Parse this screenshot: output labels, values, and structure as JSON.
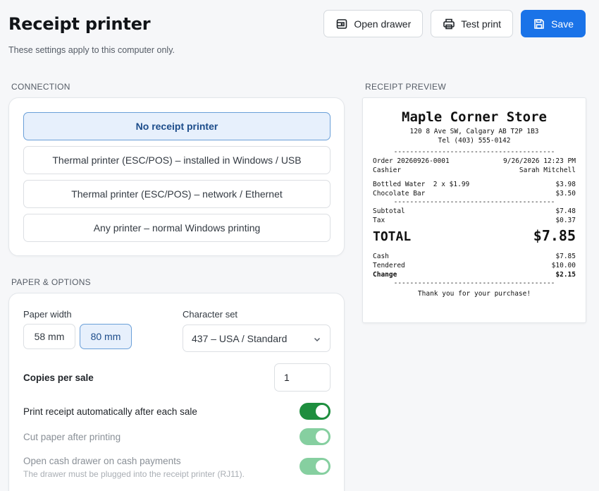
{
  "header": {
    "title": "Receipt printer",
    "subtitle": "These settings apply to this computer only."
  },
  "toolbar": {
    "open_drawer_label": "Open drawer",
    "test_print_label": "Test print",
    "save_label": "Save"
  },
  "connection": {
    "section_label": "CONNECTION",
    "options": [
      {
        "label": "No receipt printer",
        "selected": true
      },
      {
        "label": "Thermal printer (ESC/POS) – installed in Windows / USB",
        "selected": false
      },
      {
        "label": "Thermal printer (ESC/POS) – network / Ethernet",
        "selected": false
      },
      {
        "label": "Any printer – normal Windows printing",
        "selected": false
      }
    ]
  },
  "options": {
    "section_label": "PAPER & OPTIONS",
    "paper_width_label": "Paper width",
    "paper_widths": [
      "58 mm",
      "80 mm"
    ],
    "paper_width_selected": "80 mm",
    "character_set_label": "Character set",
    "character_set_value": "437 – USA / Standard",
    "copies_label": "Copies per sale",
    "copies_value": "1",
    "auto_print_label": "Print receipt automatically after each sale",
    "auto_print_on": true,
    "cut_paper_label": "Cut paper after printing",
    "cut_paper_on": true,
    "cash_drawer_label": "Open cash drawer on cash payments",
    "cash_drawer_hint": "The drawer must be plugged into the receipt printer (RJ11).",
    "cash_drawer_on": true
  },
  "receipt": {
    "section_label": "RECEIPT PREVIEW",
    "store_name": "Maple Corner Store",
    "address": "120 8 Ave SW, Calgary AB T2P 1B3",
    "phone": "Tel (403) 555-0142",
    "separator": "----------------------------------------",
    "order_label": "Order 20260926-0001",
    "order_datetime": "9/26/2026 12:23 PM",
    "cashier_label": "Cashier",
    "cashier_name": "Sarah Mitchell",
    "items": [
      {
        "name": "Bottled Water  2 x $1.99",
        "amount": "$3.98"
      },
      {
        "name": "Chocolate Bar",
        "amount": "$3.50"
      }
    ],
    "subtotal_label": "Subtotal",
    "subtotal_value": "$7.48",
    "tax_label": "Tax",
    "tax_value": "$0.37",
    "total_label": "TOTAL",
    "total_value": "$7.85",
    "payment_method_label": "Cash",
    "payment_method_value": "$7.85",
    "tendered_label": "Tendered",
    "tendered_value": "$10.00",
    "change_label": "Change",
    "change_value": "$2.15",
    "footer": "Thank you for your purchase!"
  },
  "colors": {
    "accent": "#1a73e8",
    "selected_bg": "#e7f0fc",
    "toggle_on": "#1e8e3e",
    "toggle_disabled": "#86cfa0"
  }
}
